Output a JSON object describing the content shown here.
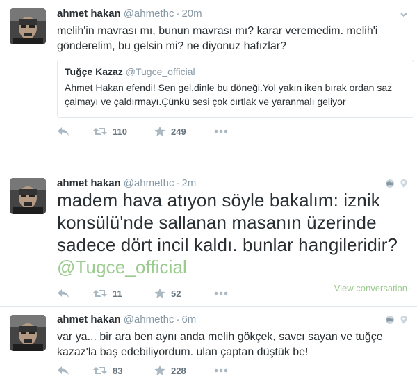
{
  "tweets": [
    {
      "name": "ahmet hakan",
      "handle": "@ahmethc",
      "sep": "·",
      "time": "20m",
      "text": "melih'in mavrası mı, bunun mavrası mı? karar veremedim. melih'i gönderelim, bu gelsin mi? ne diyonuz hafızlar?",
      "quote": {
        "name": "Tuğçe Kazaz",
        "handle": "@Tugce_official",
        "text": "Ahmet Hakan efendi! Sen gel,dinle bu döneği.Yol yakın iken bırak ordan saz çalmayı ve çaldırmayı.Çünkü sesi çok cırtlak ve yaranmalı geliyor"
      },
      "retweets": "110",
      "favorites": "249"
    },
    {
      "name": "ahmet hakan",
      "handle": "@ahmethc",
      "sep": "·",
      "time": "2m",
      "text": "madem hava atıyon söyle bakalım: iznik konsülü'nde sallanan masanın üzerinde sadece dört incil kaldı. bunlar hangileridir?",
      "mention": "@Tugce_official",
      "retweets": "11",
      "favorites": "52",
      "view_conversation": "View conversation"
    },
    {
      "name": "ahmet hakan",
      "handle": "@ahmethc",
      "sep": "·",
      "time": "6m",
      "text": "var ya... bir ara ben aynı anda melih gökçek, savcı sayan ve tuğçe kazaz'la baş edebiliyordum. ulan çaptan düştük be!",
      "retweets": "83",
      "favorites": "228"
    }
  ],
  "colors": {
    "name": "#292f33",
    "muted": "#8899a6",
    "mention": "#9ccb8f",
    "divider": "#e1e8ed"
  },
  "icons": [
    "reply-icon",
    "retweet-icon",
    "favorite-icon",
    "more-icon",
    "chevron-down-icon",
    "globe-icon",
    "location-pin-icon"
  ]
}
